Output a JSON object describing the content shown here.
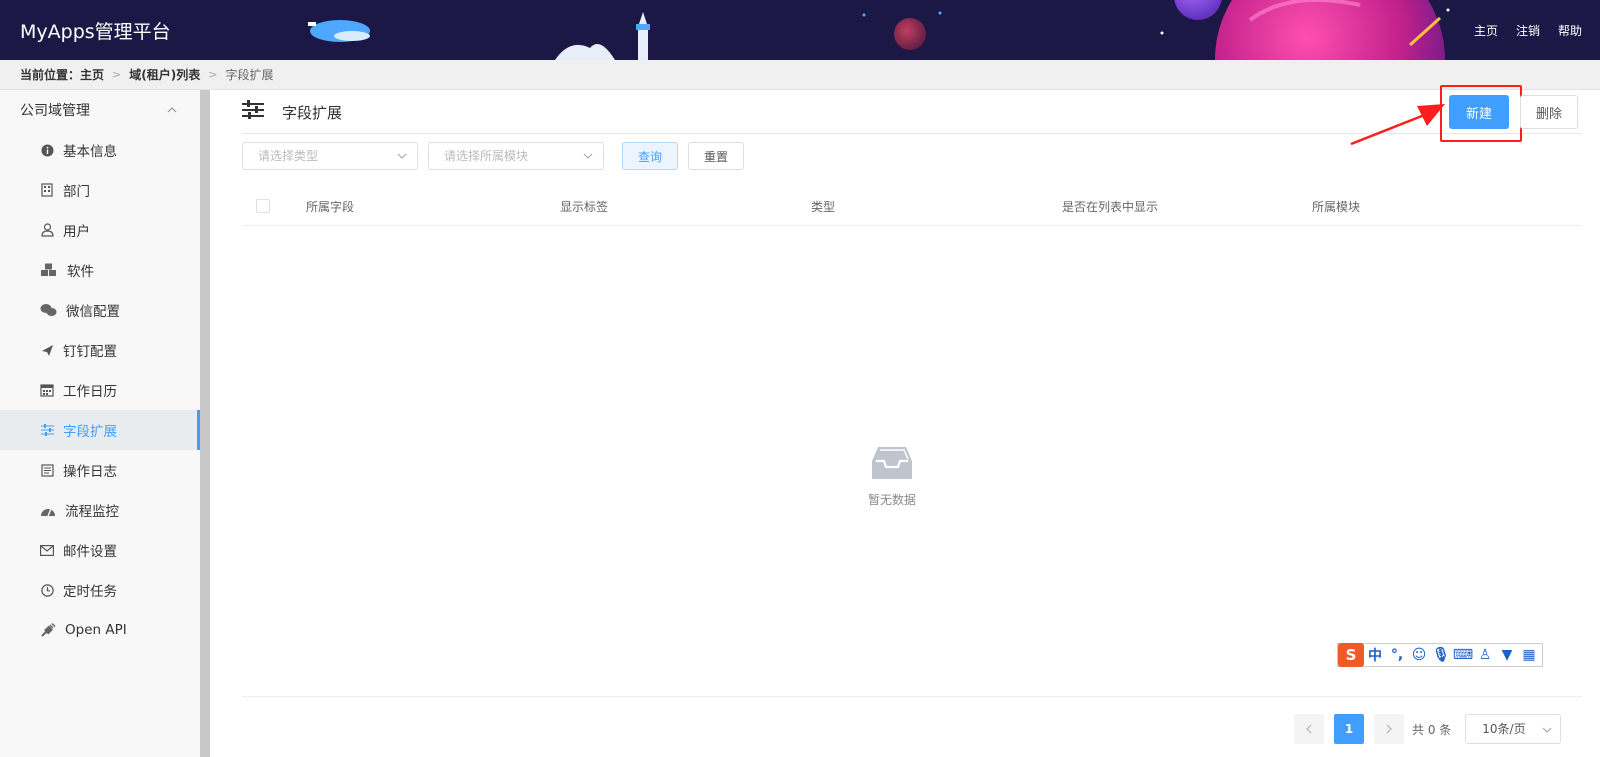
{
  "header": {
    "logo": "MyApps管理平台",
    "nav": [
      "主页",
      "注销",
      "帮助"
    ]
  },
  "breadcrumb": {
    "prefix": "当前位置：主页",
    "items": [
      "域(租户)列表",
      "字段扩展"
    ]
  },
  "sidebar": {
    "group": "公司域管理",
    "items": [
      {
        "label": "基本信息",
        "icon": "info-icon"
      },
      {
        "label": "部门",
        "icon": "building-icon"
      },
      {
        "label": "用户",
        "icon": "user-icon"
      },
      {
        "label": "软件",
        "icon": "cubes-icon"
      },
      {
        "label": "微信配置",
        "icon": "wechat-icon"
      },
      {
        "label": "钉钉配置",
        "icon": "plane-icon"
      },
      {
        "label": "工作日历",
        "icon": "calendar-icon"
      },
      {
        "label": "字段扩展",
        "icon": "sliders-icon",
        "active": true
      },
      {
        "label": "操作日志",
        "icon": "log-icon"
      },
      {
        "label": "流程监控",
        "icon": "dashboard-icon"
      },
      {
        "label": "邮件设置",
        "icon": "mail-icon"
      },
      {
        "label": "定时任务",
        "icon": "clock-icon"
      },
      {
        "label": "Open API",
        "icon": "plug-icon"
      }
    ]
  },
  "main": {
    "title": "字段扩展",
    "new_label": "新建",
    "delete_label": "删除",
    "filters": {
      "type_placeholder": "请选择类型",
      "module_placeholder": "请选择所属模块",
      "query_label": "查询",
      "reset_label": "重置"
    },
    "columns": [
      "所属字段",
      "显示标签",
      "类型",
      "是否在列表中显示",
      "所属模块"
    ],
    "empty_text": "暂无数据"
  },
  "ime": {
    "logo": "S",
    "mode": "中"
  },
  "pagination": {
    "current": "1",
    "total": "共 0 条",
    "page_size": "10条/页"
  },
  "colors": {
    "header_bg": "#1c1845",
    "accent": "#409eff",
    "highlight": "#ff1e1e"
  }
}
